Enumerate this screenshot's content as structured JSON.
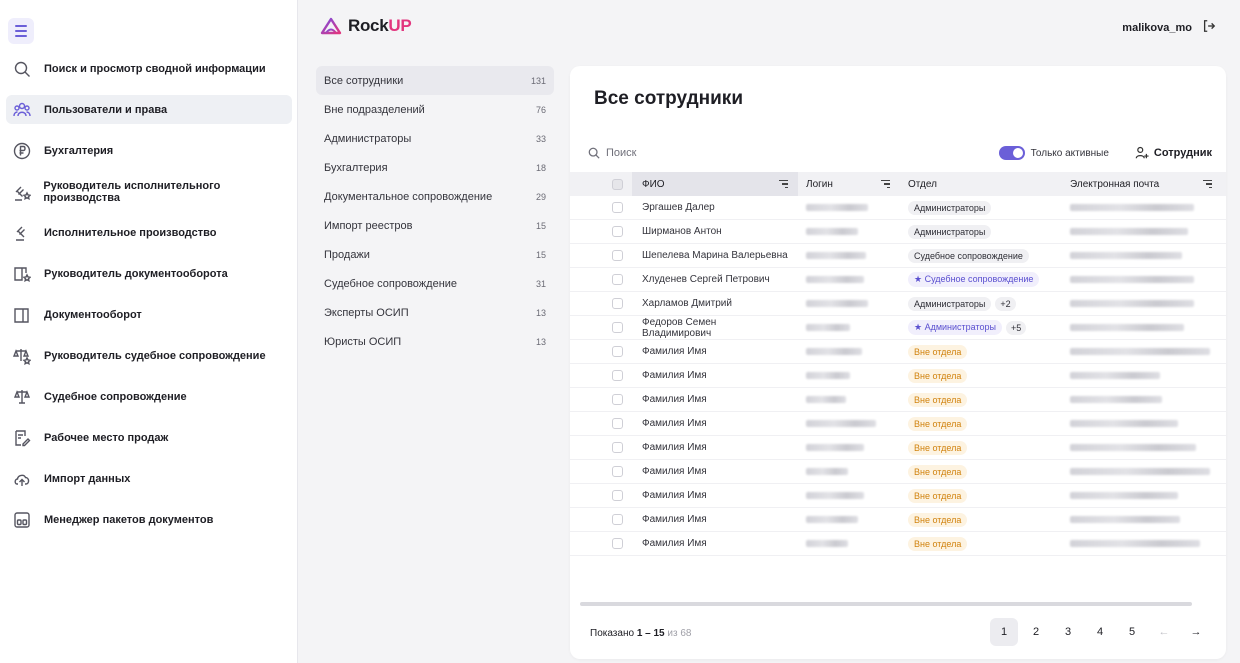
{
  "header": {
    "logo_main": "Rock",
    "logo_accent": "UP",
    "username": "malikova_mo"
  },
  "sidebar": {
    "items": [
      {
        "label": "Поиск и просмотр сводной информации",
        "icon": "search-icon",
        "active": false
      },
      {
        "label": "Пользователи и права",
        "icon": "users-icon",
        "active": true
      },
      {
        "label": "Бухгалтерия",
        "icon": "accounting-icon",
        "active": false
      },
      {
        "label": "Руководитель исполнительного производства",
        "icon": "gavel-star-icon",
        "active": false
      },
      {
        "label": "Исполнительное производство",
        "icon": "gavel-icon",
        "active": false
      },
      {
        "label": "Руководитель документооборота",
        "icon": "documents-star-icon",
        "active": false
      },
      {
        "label": "Документооборот",
        "icon": "documents-icon",
        "active": false
      },
      {
        "label": "Руководитель судебное сопровождение",
        "icon": "scales-star-icon",
        "active": false
      },
      {
        "label": "Судебное сопровождение",
        "icon": "scales-icon",
        "active": false
      },
      {
        "label": "Рабочее место продаж",
        "icon": "sales-icon",
        "active": false
      },
      {
        "label": "Импорт данных",
        "icon": "cloud-upload-icon",
        "active": false
      },
      {
        "label": "Менеджер пакетов документов",
        "icon": "package-icon",
        "active": false
      }
    ]
  },
  "departments": [
    {
      "label": "Все сотрудники",
      "count": "131",
      "active": true
    },
    {
      "label": "Вне подразделений",
      "count": "76",
      "active": false
    },
    {
      "label": "Администраторы",
      "count": "33",
      "active": false
    },
    {
      "label": "Бухгалтерия",
      "count": "18",
      "active": false
    },
    {
      "label": "Документальное сопровождение",
      "count": "29",
      "active": false
    },
    {
      "label": "Импорт реестров",
      "count": "15",
      "active": false
    },
    {
      "label": "Продажи",
      "count": "15",
      "active": false
    },
    {
      "label": "Судебное сопровождение",
      "count": "31",
      "active": false
    },
    {
      "label": "Эксперты ОСИП",
      "count": "13",
      "active": false
    },
    {
      "label": "Юристы ОСИП",
      "count": "13",
      "active": false
    }
  ],
  "main": {
    "title": "Все сотрудники",
    "search_placeholder": "Поиск",
    "toggle_label": "Только активные",
    "add_label": "Сотрудник",
    "columns": {
      "fio": "ФИО",
      "login": "Логин",
      "dept": "Отдел",
      "email": "Электронная почта"
    },
    "rows": [
      {
        "fio": "Эргашев Далер",
        "dept": "Администраторы",
        "dept_kind": "plain",
        "more": ""
      },
      {
        "fio": "Ширманов Антон",
        "dept": "Администраторы",
        "dept_kind": "plain",
        "more": ""
      },
      {
        "fio": "Шепелева Марина Валерьевна",
        "dept": "Судебное сопровождение",
        "dept_kind": "plain",
        "more": ""
      },
      {
        "fio": "Хлуденев Сергей Петрович",
        "dept": "Судебное сопровождение",
        "dept_kind": "star",
        "more": ""
      },
      {
        "fio": "Харламов Дмитрий",
        "dept": "Администраторы",
        "dept_kind": "plain",
        "more": "+2"
      },
      {
        "fio": "Федоров Семен Владимирович",
        "dept": "Администраторы",
        "dept_kind": "star",
        "more": "+5"
      },
      {
        "fio": "Фамилия Имя",
        "dept": "Вне отдела",
        "dept_kind": "none",
        "more": ""
      },
      {
        "fio": "Фамилия Имя",
        "dept": "Вне отдела",
        "dept_kind": "none",
        "more": ""
      },
      {
        "fio": "Фамилия Имя",
        "dept": "Вне отдела",
        "dept_kind": "none",
        "more": ""
      },
      {
        "fio": "Фамилия Имя",
        "dept": "Вне отдела",
        "dept_kind": "none",
        "more": ""
      },
      {
        "fio": "Фамилия Имя",
        "dept": "Вне отдела",
        "dept_kind": "none",
        "more": ""
      },
      {
        "fio": "Фамилия Имя",
        "dept": "Вне отдела",
        "dept_kind": "none",
        "more": ""
      },
      {
        "fio": "Фамилия Имя",
        "dept": "Вне отдела",
        "dept_kind": "none",
        "more": ""
      },
      {
        "fio": "Фамилия Имя",
        "dept": "Вне отдела",
        "dept_kind": "none",
        "more": ""
      },
      {
        "fio": "Фамилия Имя",
        "dept": "Вне отдела",
        "dept_kind": "none",
        "more": ""
      }
    ],
    "footer": {
      "shown_prefix": "Показано",
      "shown_range": "1 – 15",
      "shown_of": "из 68"
    },
    "pages": [
      "1",
      "2",
      "3",
      "4",
      "5"
    ],
    "current_page": "1"
  },
  "colors": {
    "accent": "#6b5fd8",
    "brand_pink": "#e2357e",
    "warning": "#d1830f"
  }
}
